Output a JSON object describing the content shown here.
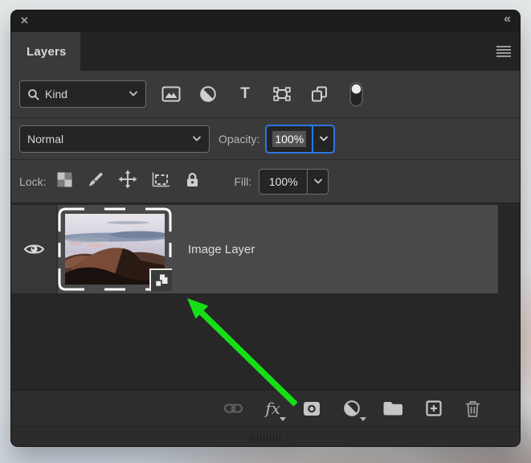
{
  "window": {
    "close_glyph": "✕",
    "collapse_glyph": "«"
  },
  "tab_label": "Layers",
  "filter_row": {
    "kind_label": "Kind",
    "type_filter_glyph": "T",
    "filter_names": [
      "pixel-layers",
      "adjustment-layers",
      "type-layers",
      "shape-layers",
      "smart-objects"
    ],
    "filtering_toggle_on": true
  },
  "blend_row": {
    "mode": "Normal",
    "opacity_label": "Opacity:",
    "opacity_value": "100%"
  },
  "lock_row": {
    "label": "Lock:",
    "lock_icon_names": [
      "lock-transparent-pixels",
      "lock-image-pixels",
      "lock-position",
      "lock-artboard-nesting",
      "lock-all"
    ],
    "fill_label": "Fill:",
    "fill_value": "100%"
  },
  "layers": [
    {
      "name": "Image Layer",
      "visible": true,
      "selected": true,
      "smart_object": true,
      "thumbnail": "desert-dunes-at-dusk"
    }
  ],
  "toolbar": {
    "fx_label": "fx",
    "icon_names": [
      "link-layers",
      "layer-style-fx",
      "add-layer-mask",
      "new-adjustment-layer",
      "new-group",
      "new-layer",
      "delete-layer"
    ]
  },
  "annotation": {
    "arrow_target": "smart-object-badge",
    "arrow_color": "#17df17"
  },
  "colors": {
    "panel_bg": "#3a3a3a",
    "list_bg": "#272727",
    "selected_row": "#494949",
    "header_bg": "#1d1d1d",
    "focus_blue": "#2b76e1"
  }
}
